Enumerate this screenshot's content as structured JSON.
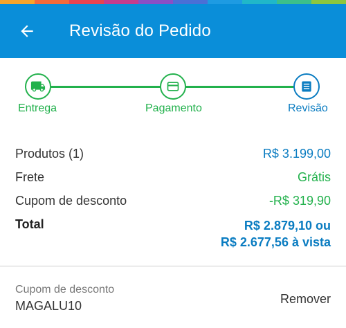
{
  "colors": {
    "appbar": "#0a8ed9",
    "green": "#22b14c",
    "blue": "#0a7cc1",
    "rainbow": [
      "#f7a42b",
      "#f46a3a",
      "#e8434f",
      "#c63c8d",
      "#8a4fc5",
      "#4b6fd6",
      "#1e9be2",
      "#20b7c9",
      "#3cc08a",
      "#8dc63f"
    ]
  },
  "appbar": {
    "back_icon": "arrow-left-icon",
    "title": "Revisão do Pedido"
  },
  "stepper": {
    "steps": [
      {
        "label": "Entrega",
        "icon": "truck-icon",
        "state": "done"
      },
      {
        "label": "Pagamento",
        "icon": "card-icon",
        "state": "done"
      },
      {
        "label": "Revisão",
        "icon": "list-icon",
        "state": "current"
      }
    ]
  },
  "summary": {
    "products_label": "Produtos (1)",
    "products_value": "R$ 3.199,00",
    "shipping_label": "Frete",
    "shipping_value": "Grátis",
    "coupon_label": "Cupom de desconto",
    "coupon_value": "-R$ 319,90",
    "total_label": "Total",
    "total_value": "R$ 2.879,10 ou",
    "total_cash_value": "R$ 2.677,56 à vista"
  },
  "coupon": {
    "caption": "Cupom de desconto",
    "code": "MAGALU10",
    "remove_label": "Remover"
  }
}
